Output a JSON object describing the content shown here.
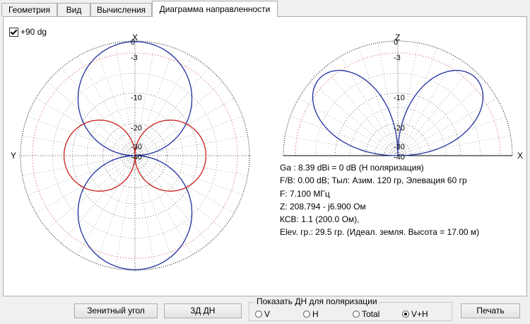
{
  "tabs": [
    "Геометрия",
    "Вид",
    "Вычисления",
    "Диаграмма направленности"
  ],
  "checkbox": {
    "label": "+90 dg",
    "checked": true
  },
  "azimuth": {
    "axis_top": "X",
    "axis_left": "Y",
    "ring_labels": [
      "0",
      "-3",
      "-10",
      "-20",
      "-30",
      "-40"
    ]
  },
  "elevation": {
    "axis_top": "Z",
    "axis_right": "X",
    "ring_labels": [
      "0",
      "-3",
      "-10",
      "-20",
      "-30",
      "-40"
    ]
  },
  "info": {
    "gain": "Ga : 8.39 dBi = 0 dB  (H поляризация)",
    "fb": "F/B: 0.00 dB; Тыл: Азим. 120 гр, Элевация 60 гр",
    "freq": "F: 7.100 МГц",
    "impedance": "Z: 208.794 - j6.900 Ом",
    "swr": "КСВ: 1.1 (200.0 Ом),",
    "elev": "Elev. гр.: 29.5 гр. (Идеал. земля. Высота = 17.00 м)"
  },
  "buttons": {
    "zenith": "Зенитный угол",
    "view3d": "3Д   ДН",
    "print": "Печать"
  },
  "polarization": {
    "title": "Показать ДН для поляризации",
    "options": [
      "V",
      "H",
      "Total",
      "V+H"
    ],
    "selected": "V+H"
  },
  "colors": {
    "blue": "#1f2f9f",
    "red": "#c81e1e"
  }
}
